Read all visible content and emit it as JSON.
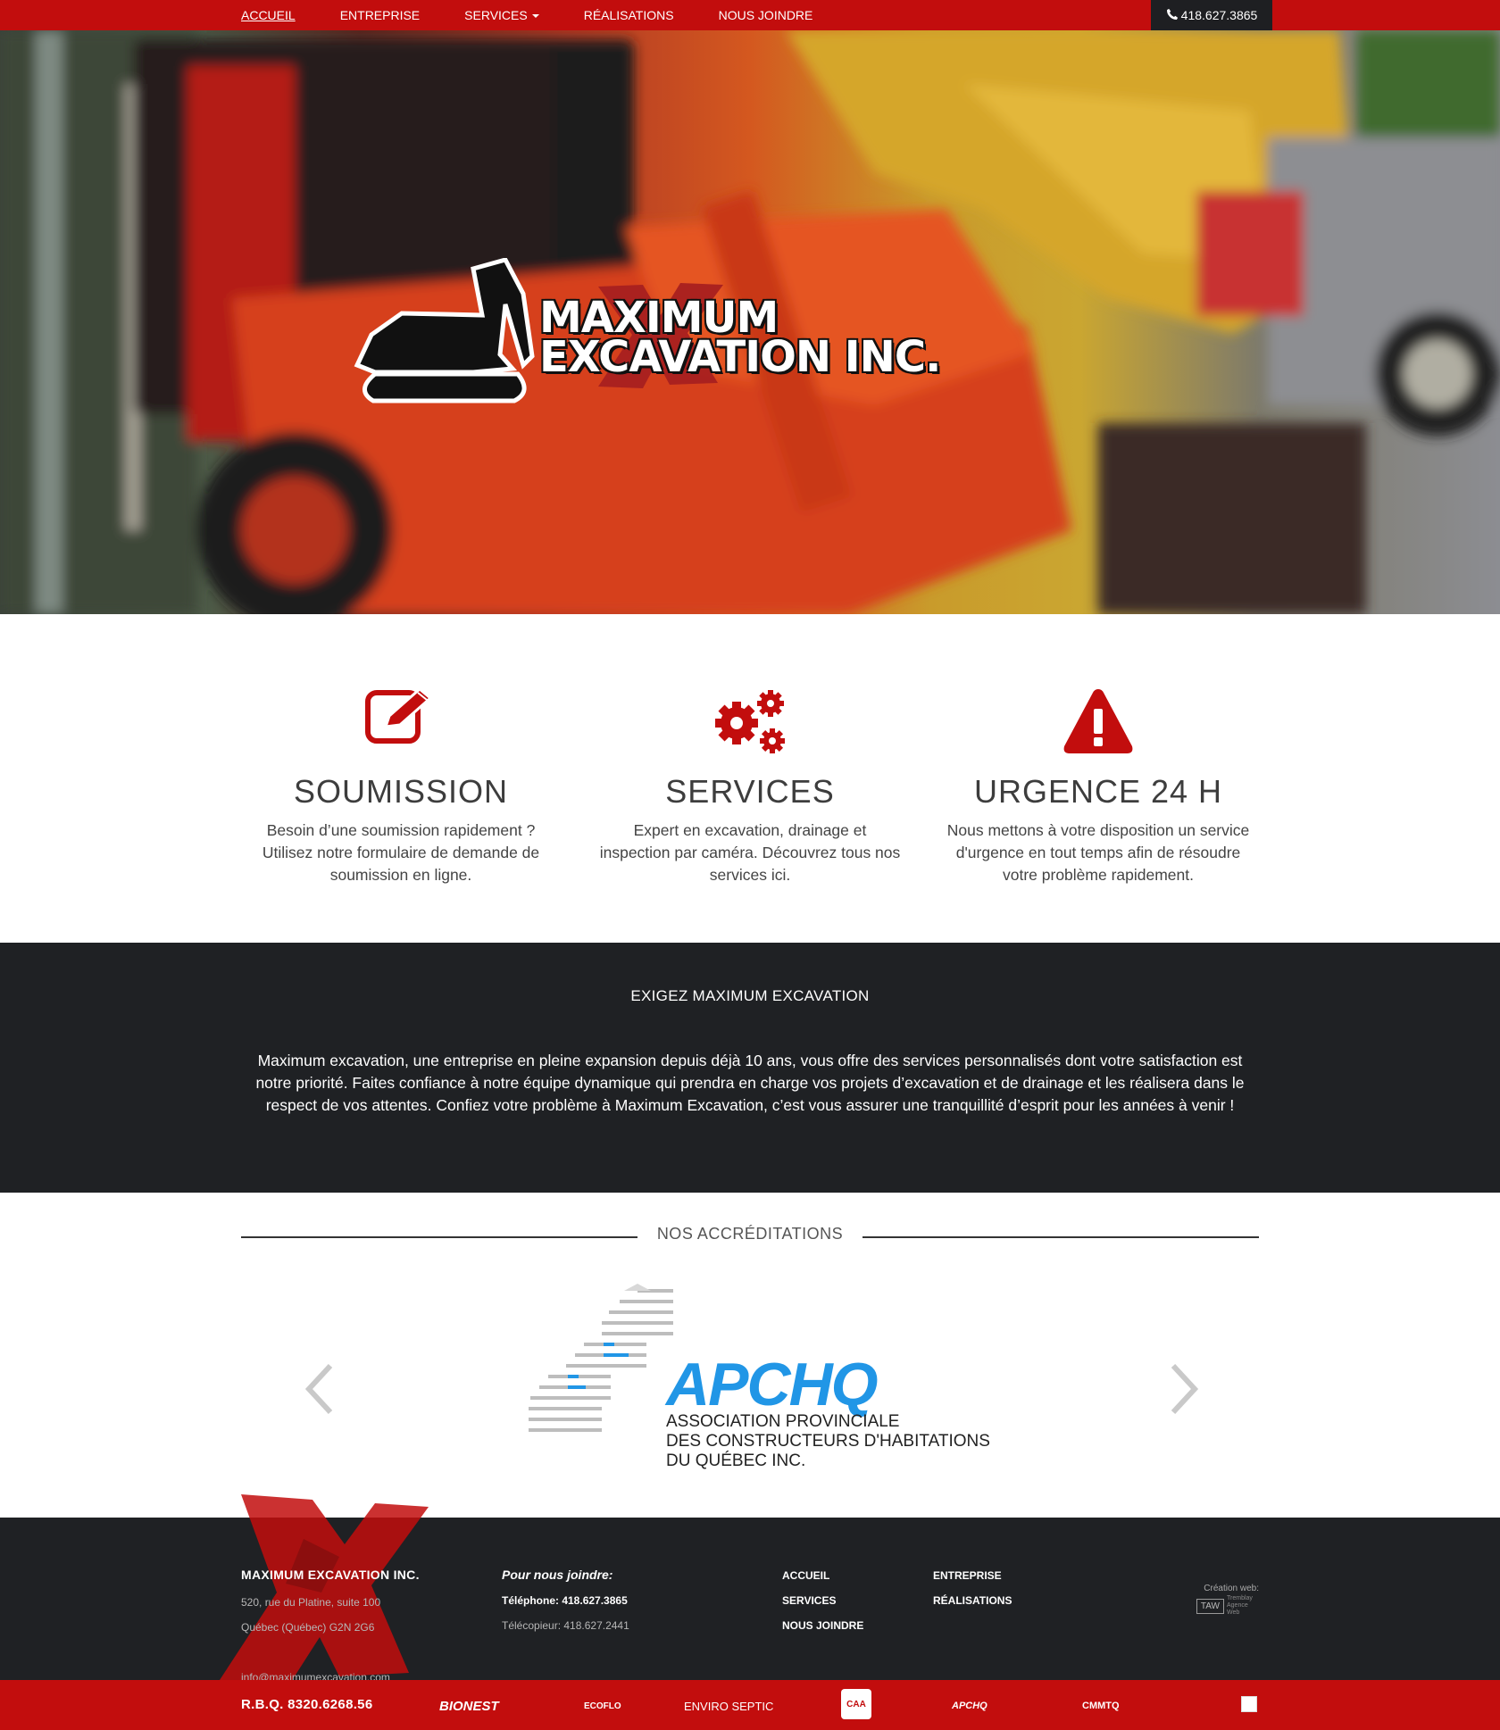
{
  "nav": {
    "items": [
      "ACCUEIL",
      "ENTREPRISE",
      "SERVICES",
      "RÉALISATIONS",
      "NOUS JOINDRE"
    ],
    "active": "ACCUEIL",
    "phone": "418.627.3865"
  },
  "hero": {
    "logo_line1": "MAXIMUM",
    "logo_line2": "EXCAVATION INC.",
    "background": "blurred photo of red Kubota tractor and yellow CAT excavator"
  },
  "features": [
    {
      "icon": "edit-icon",
      "title": "SOUMISSION",
      "text": "Besoin d’une soumission rapidement ? Utilisez notre formulaire de demande de soumission en ligne."
    },
    {
      "icon": "gears-icon",
      "title": "SERVICES",
      "text": "Expert en excavation, drainage et inspection par caméra. Découvrez tous nos services ici."
    },
    {
      "icon": "warning-icon",
      "title": "URGENCE 24 H",
      "text": "Nous mettons à votre disposition un service d'urgence en tout temps afin de résoudre votre problème rapidement."
    }
  ],
  "about": {
    "heading": "EXIGEZ MAXIMUM EXCAVATION",
    "text": "Maximum excavation, une entreprise en pleine expansion depuis déjà 10 ans, vous offre des services personnalisés dont votre satisfaction est notre priorité. Faites confiance à notre équipe dynamique qui prendra en charge vos projets d’excavation et de drainage et les réalisera dans le respect de vos attentes. Confiez votre problème à Maximum Excavation, c’est vous assurer une tranquillité d’esprit pour les années à venir !"
  },
  "accreditations": {
    "heading": "NOS ACCRÉDITATIONS",
    "current": {
      "name": "APCHQ",
      "line1": "ASSOCIATION PROVINCIALE",
      "line2": "DES CONSTRUCTEURS D'HABITATIONS",
      "line3": "DU QUÉBEC INC."
    }
  },
  "footer": {
    "company": "MAXIMUM EXCAVATION INC.",
    "address1": "520, rue du Platine, suite 100",
    "address2": "Québec (Québec) G2N 2G6",
    "email": "info@maximumexcavation.com",
    "contact_label": "Pour nous joindre:",
    "phone": "Téléphone: 418.627.3865",
    "fax": "Télécopieur: 418.627.2441",
    "links_col1": [
      "ACCUEIL",
      "SERVICES",
      "NOUS JOINDRE"
    ],
    "links_col2": [
      "ENTREPRISE",
      "RÉALISATIONS"
    ],
    "credit_label": "Création web:",
    "credit_name": "TAW",
    "credit_tag": "Tremblay Agence Web"
  },
  "bottombar": {
    "rbq": "R.B.Q. 8320.6268.56",
    "partners": [
      "BIONEST",
      "ECOFLO",
      "ENVIRO SEPTIC",
      "CAA",
      "APCHQ",
      "CMMTQ"
    ]
  },
  "colors": {
    "brand_red": "#c20d0d",
    "dark": "#1f2124",
    "apchq_blue": "#2196e6"
  }
}
